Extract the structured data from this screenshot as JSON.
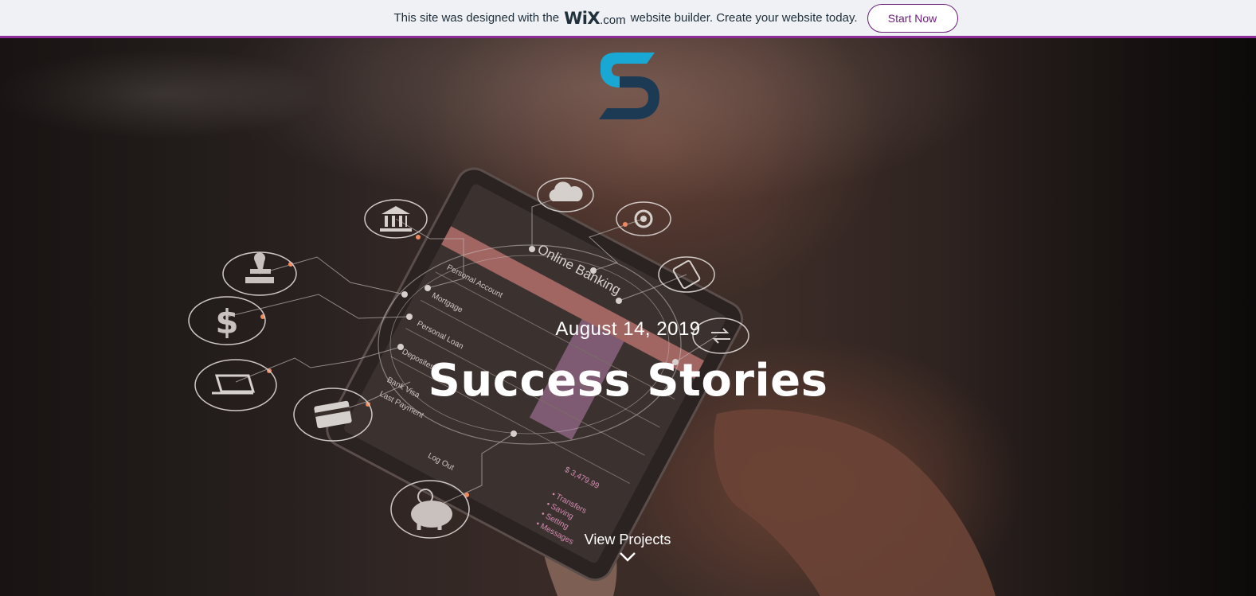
{
  "banner": {
    "text_before": "This site was designed with the",
    "logo_wix": "WiX",
    "logo_dotcom": ".com",
    "text_after": "website builder. Create your website today.",
    "cta_label": "Start Now",
    "accent_color": "#8e2c9a"
  },
  "site_logo": {
    "icon": "s-logo-icon",
    "colors": [
      "#19a8d4",
      "#1d3a55"
    ]
  },
  "hero": {
    "date": "August 14, 2019",
    "title": "Success Stories",
    "scroll_label": "View Projects",
    "scroll_icon": "chevron-down-icon",
    "tablet_screen_title": "Online Banking",
    "tablet_rows": [
      "Personal Account",
      "Mortgage",
      "Personal Loan",
      "Deposites",
      "Bank Visa",
      "Last Payment",
      "Log Out"
    ],
    "tablet_menu": [
      "Transfers",
      "Saving",
      "Setting",
      "Messages"
    ],
    "tablet_amount": "$ 3,479.99",
    "circle_icons": [
      "bank-icon",
      "cloud-icon",
      "lock-icon",
      "phone-icon",
      "transfer-icon",
      "stamp-icon",
      "dollar-icon",
      "laptop-icon",
      "card-icon",
      "piggy-bank-icon"
    ]
  }
}
